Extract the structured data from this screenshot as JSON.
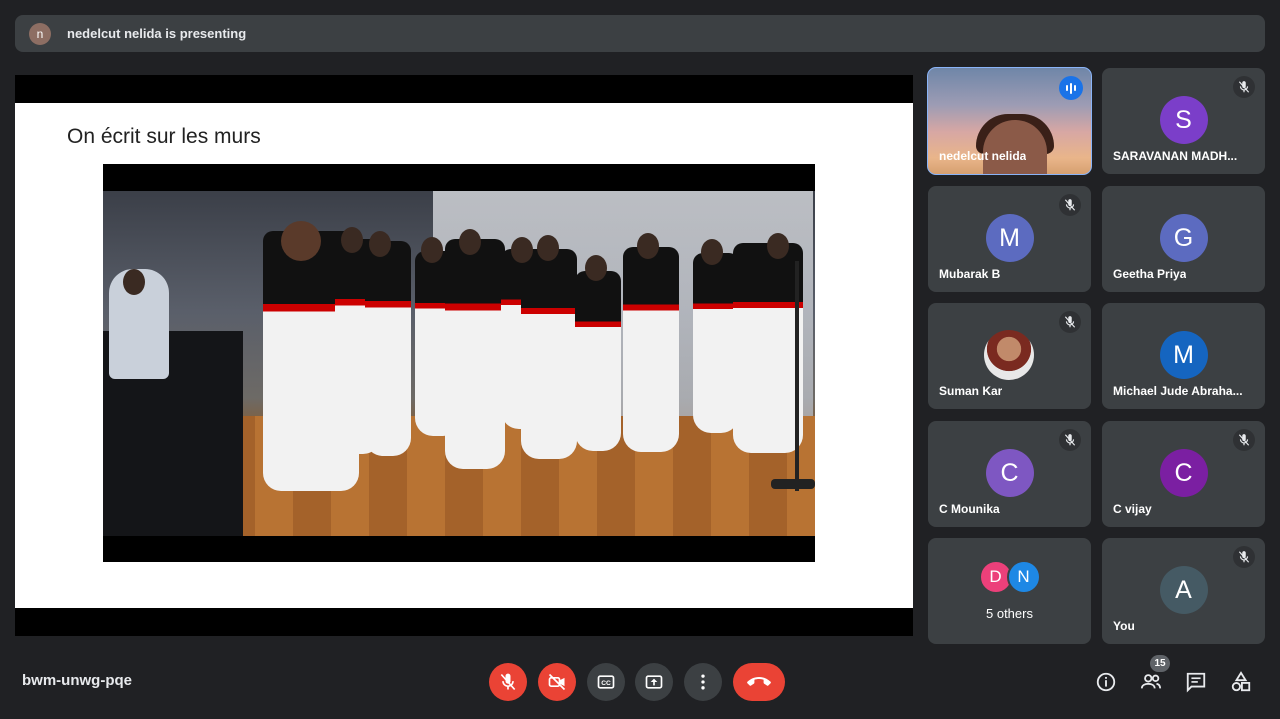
{
  "banner": {
    "avatar_letter": "n",
    "text": "nedelcut nelida is presenting"
  },
  "slide": {
    "title": "On écrit sur les murs"
  },
  "participants": [
    {
      "name": "nedelcut nelida",
      "speaking": true
    },
    {
      "name": "SARAVANAN MADH...",
      "letter": "S",
      "color": "#7b3ec9",
      "muted": true
    },
    {
      "name": "Mubarak B",
      "letter": "M",
      "color": "#5c6bc0",
      "muted": true
    },
    {
      "name": "Geetha Priya",
      "letter": "G",
      "color": "#5c6bc0",
      "muted": false
    },
    {
      "name": "Suman Kar",
      "muted": true
    },
    {
      "name": "Michael Jude Abraha...",
      "letter": "M",
      "color": "#1565c0",
      "muted": false
    },
    {
      "name": "C Mounika",
      "letter": "C",
      "color": "#7e57c2",
      "muted": true
    },
    {
      "name": "C vijay",
      "letter": "C",
      "color": "#7b1fa2",
      "muted": true
    },
    {
      "name": "You",
      "letter": "A",
      "color": "#455a64",
      "muted": true
    }
  ],
  "others": {
    "letters": [
      "D",
      "N"
    ],
    "colors": [
      "#ec407a",
      "#1e88e5"
    ],
    "label": "5 others"
  },
  "bottom": {
    "meeting_code": "bwm-unwg-pqe",
    "participant_count": "15"
  },
  "colors": {
    "danger": "#ea4335",
    "tile": "#3c4043",
    "background": "#202124",
    "active_outline": "#8ab4f8"
  }
}
